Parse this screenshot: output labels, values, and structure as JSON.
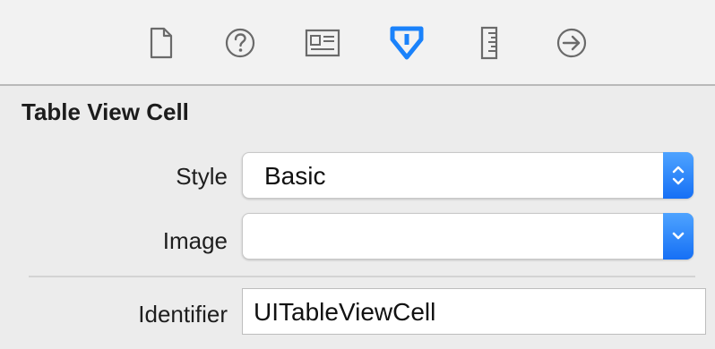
{
  "toolbar": {
    "icons": [
      "file-inspector-icon",
      "quick-help-icon",
      "identity-inspector-icon",
      "attributes-inspector-icon",
      "size-inspector-icon",
      "connections-inspector-icon"
    ],
    "active_icon": "attributes-inspector-icon",
    "accent_color": "#1a82fb"
  },
  "section": {
    "title": "Table View Cell"
  },
  "fields": {
    "style": {
      "label": "Style",
      "value": "Basic"
    },
    "image": {
      "label": "Image",
      "value": ""
    },
    "identifier": {
      "label": "Identifier",
      "value": "UITableViewCell"
    }
  }
}
